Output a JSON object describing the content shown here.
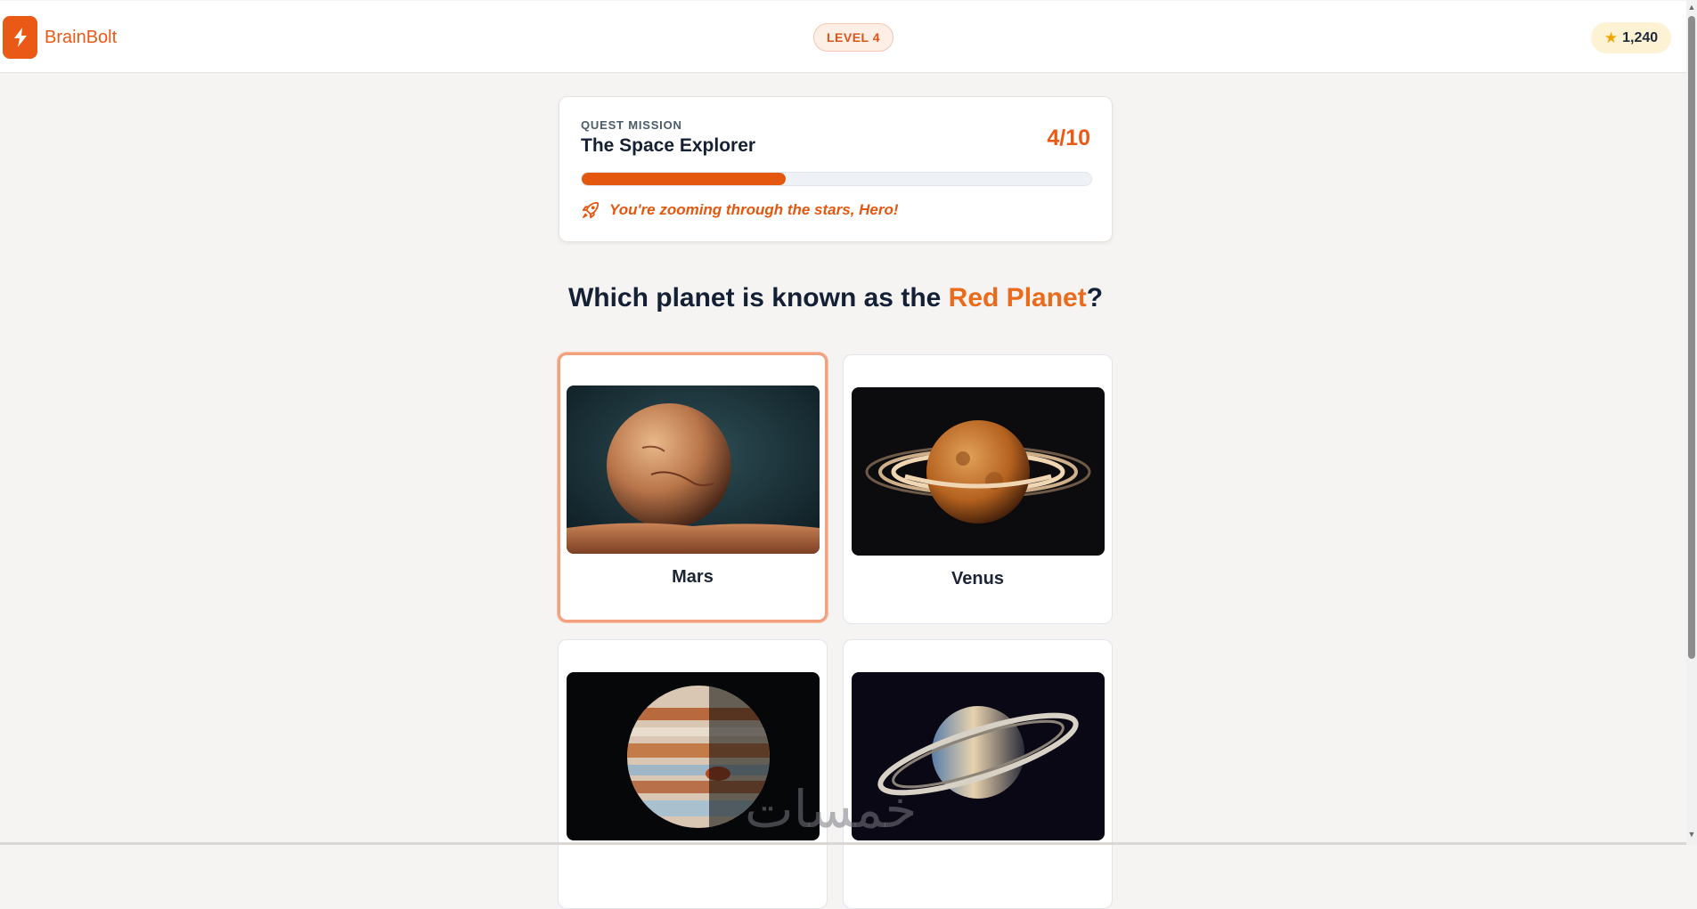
{
  "header": {
    "brand_name": "BrainBolt",
    "level_label": "LEVEL 4",
    "points": "1,240",
    "icons": {
      "logo": "lightning-bolt-icon",
      "points": "star-icon"
    }
  },
  "mission": {
    "kicker": "QUEST MISSION",
    "title": "The Space Explorer",
    "count": "4/10",
    "progress": 0.4,
    "message": "You're zooming through the stars, Hero!",
    "message_icon": "rocket-icon"
  },
  "question": {
    "prefix": "Which planet is known as the ",
    "highlight": "Red Planet",
    "suffix": "?"
  },
  "options": [
    {
      "label": "Mars",
      "selected": true
    },
    {
      "label": "Venus",
      "selected": false
    },
    {
      "label": "",
      "selected": false
    },
    {
      "label": "",
      "selected": false
    }
  ],
  "watermark": "خمسات",
  "colors": {
    "accent": "#ea5a16",
    "background": "#f6f4f3",
    "selected_border": "#f2a07e",
    "star": "#f0a500"
  }
}
